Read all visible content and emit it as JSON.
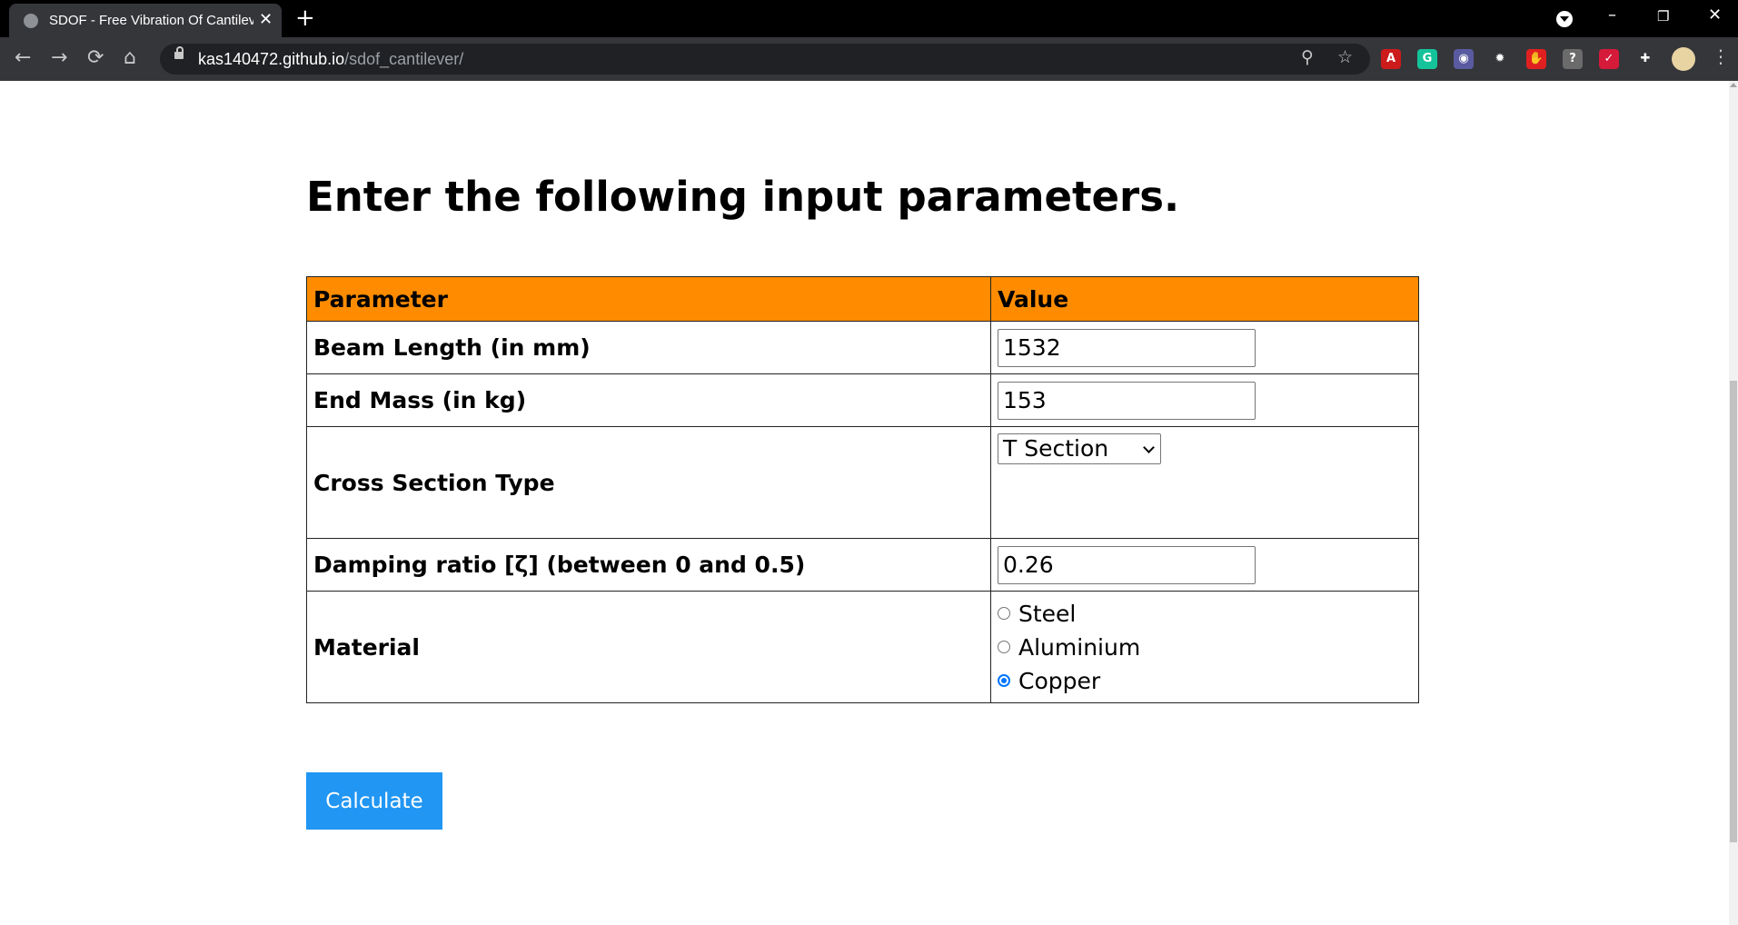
{
  "browser": {
    "tab_title": "SDOF - Free Vibration Of Cantilever",
    "tab_close": "✕",
    "new_tab": "+",
    "url_host": "kas140472.github.io",
    "url_path": "/sdof_cantilever/",
    "back": "←",
    "forward": "→",
    "reload": "⟳",
    "home": "⌂",
    "zoom": "⚲",
    "bookmark": "☆",
    "minimize": "–",
    "restore": "❐",
    "close": "✕",
    "menu": "⋮",
    "extensions": [
      {
        "name": "acrobat-extension-icon",
        "glyph": "A",
        "color": "#cc1b1b"
      },
      {
        "name": "grammarly-extension-icon",
        "glyph": "G",
        "color": "#15c39a"
      },
      {
        "name": "eyes-extension-icon",
        "glyph": "◉",
        "color": "#5a5aa0"
      },
      {
        "name": "gear-extension-icon",
        "glyph": "✹",
        "color": "#35363a"
      },
      {
        "name": "hand-extension-icon",
        "glyph": "✋",
        "color": "#e02020"
      },
      {
        "name": "help-extension-icon",
        "glyph": "?",
        "color": "#6b6b6b"
      },
      {
        "name": "pocket-extension-icon",
        "glyph": "✓",
        "color": "#d51a3a"
      },
      {
        "name": "puzzle-extension-icon",
        "glyph": "✚",
        "color": "#35363a"
      }
    ]
  },
  "page": {
    "heading": "Enter the following input parameters.",
    "table": {
      "headers": [
        "Parameter",
        "Value"
      ],
      "beam_length": {
        "label": "Beam Length (in mm)",
        "value": "1532"
      },
      "end_mass": {
        "label": "End Mass (in kg)",
        "value": "153"
      },
      "cross_section": {
        "label": "Cross Section Type",
        "selected": "T Section"
      },
      "damping": {
        "label": "Damping ratio [ζ] (between 0 and 0.5)",
        "value": "0.26"
      },
      "material": {
        "label": "Material",
        "options": [
          "Steel",
          "Aluminium",
          "Copper"
        ],
        "selected": "Copper"
      }
    },
    "calculate_label": "Calculate"
  }
}
